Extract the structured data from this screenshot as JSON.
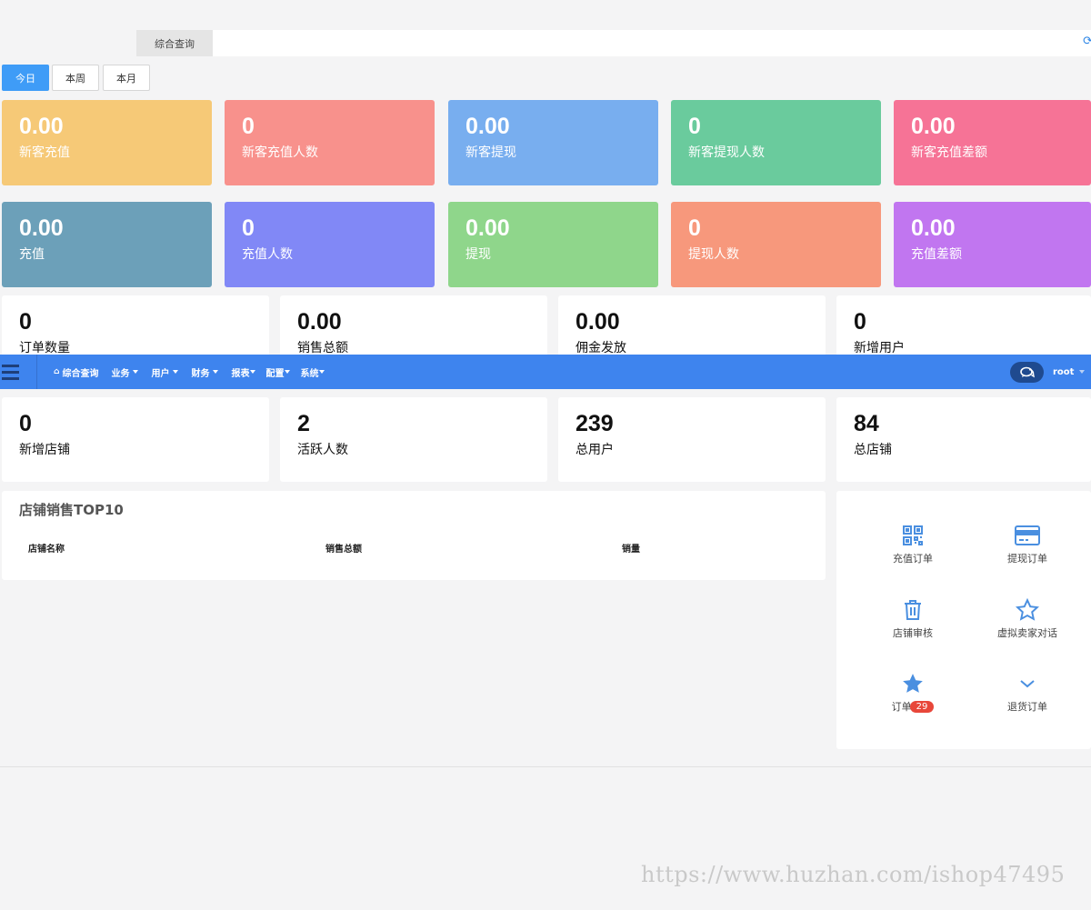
{
  "tabbar": {
    "active_tab": "综合查询"
  },
  "period_buttons": [
    "今日",
    "本周",
    "本月"
  ],
  "cards_row1": [
    {
      "value": "0.00",
      "label": "新客充值",
      "color": "#f6c977"
    },
    {
      "value": "0",
      "label": "新客充值人数",
      "color": "#f8918c"
    },
    {
      "value": "0.00",
      "label": "新客提现",
      "color": "#78aeef"
    },
    {
      "value": "0",
      "label": "新客提现人数",
      "color": "#6acb9d"
    },
    {
      "value": "0.00",
      "label": "新客充值差额",
      "color": "#f67396"
    }
  ],
  "cards_row2": [
    {
      "value": "0.00",
      "label": "充值",
      "color": "#6ca0b9"
    },
    {
      "value": "0",
      "label": "充值人数",
      "color": "#8188f6"
    },
    {
      "value": "0.00",
      "label": "提现",
      "color": "#8fd68b"
    },
    {
      "value": "0",
      "label": "提现人数",
      "color": "#f7987c"
    },
    {
      "value": "0.00",
      "label": "充值差额",
      "color": "#c176f0"
    }
  ],
  "stats_row1": [
    {
      "value": "0",
      "label": "订单数量"
    },
    {
      "value": "0.00",
      "label": "销售总额"
    },
    {
      "value": "0.00",
      "label": "佣金发放"
    },
    {
      "value": "0",
      "label": "新增用户"
    }
  ],
  "stats_row2": [
    {
      "value": "0",
      "label": "新增店铺"
    },
    {
      "value": "2",
      "label": "活跃人数"
    },
    {
      "value": "239",
      "label": "总用户"
    },
    {
      "value": "84",
      "label": "总店铺"
    }
  ],
  "navbar": {
    "menu": [
      "综合查询",
      "业务",
      "用户",
      "财务",
      "报表",
      "配置",
      "系统"
    ],
    "user": "root",
    "color": "#3e84ee"
  },
  "top10": {
    "title": "店铺销售TOP10",
    "columns": [
      "店铺名称",
      "销售总额",
      "销量"
    ]
  },
  "quick_links": [
    {
      "label": "充值订单",
      "icon": "qrcode-icon"
    },
    {
      "label": "提现订单",
      "icon": "credit-card-icon"
    },
    {
      "label": "店铺审核",
      "icon": "trash-icon"
    },
    {
      "label": "虚拟卖家对话",
      "icon": "star-outline-icon"
    },
    {
      "label": "订单",
      "icon": "star-icon",
      "badge": "29"
    },
    {
      "label": "退货订单",
      "icon": "chevron-down-icon"
    }
  ],
  "watermark": "https://www.huzhan.com/ishop47495"
}
